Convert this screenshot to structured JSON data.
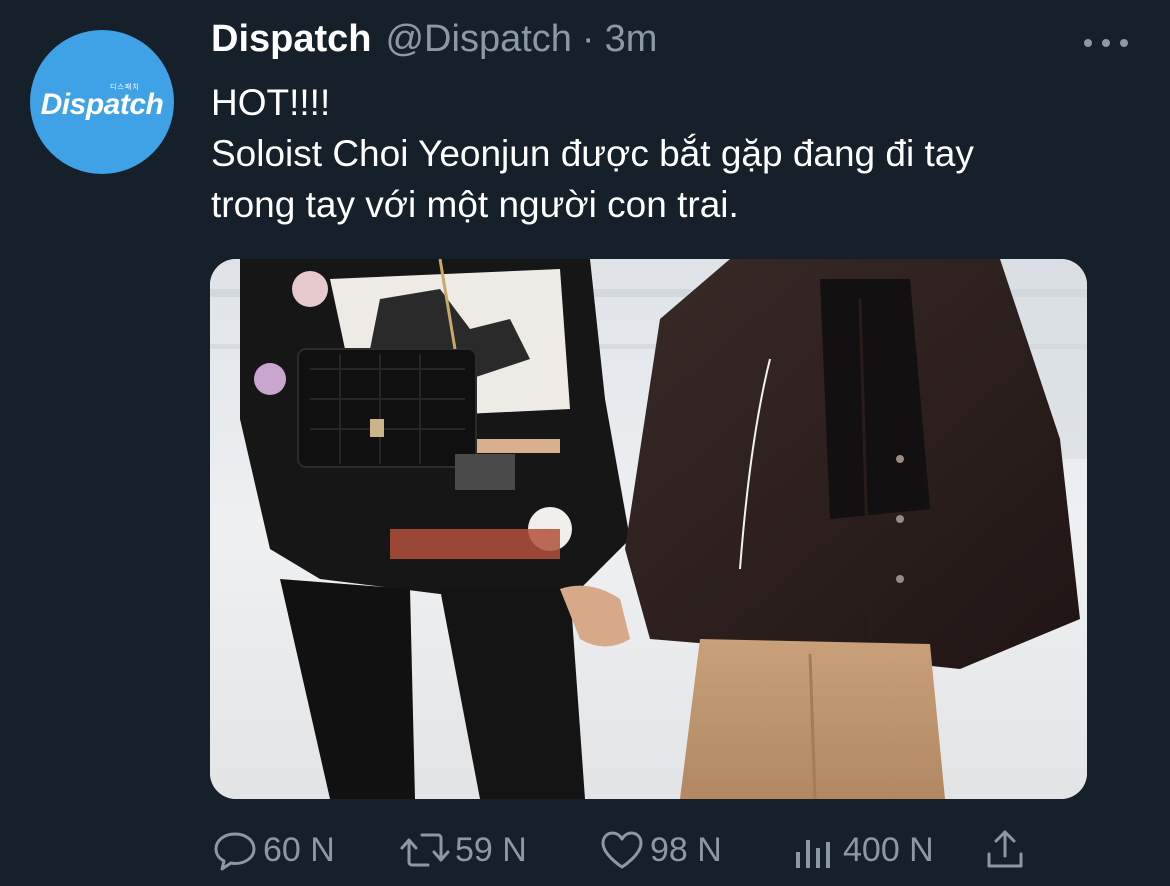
{
  "tweet": {
    "avatar_logo_text": "Dispatch",
    "avatar_sub_text": "디스패치",
    "display_name": "Dispatch",
    "handle": "@Dispatch",
    "separator": "·",
    "time": "3m",
    "text_lines": [
      "HOT!!!!",
      "Soloist Choi Yeonjun được bắt gặp đang đi tay",
      "trong tay với một người con trai."
    ],
    "media": {
      "image_icon": "photo-of-two-people-holding-hands"
    },
    "actions": {
      "reply_count": "60 N",
      "retweet_count": "59 N",
      "like_count": "98 N",
      "views_count": "400 N"
    }
  },
  "colors": {
    "background": "#15202b",
    "text_primary": "#ffffff",
    "text_secondary": "#8b98a5",
    "avatar_blue": "#3fa1e6"
  },
  "icons": [
    "reply-icon",
    "retweet-icon",
    "like-icon",
    "views-icon",
    "share-icon",
    "more-icon"
  ]
}
